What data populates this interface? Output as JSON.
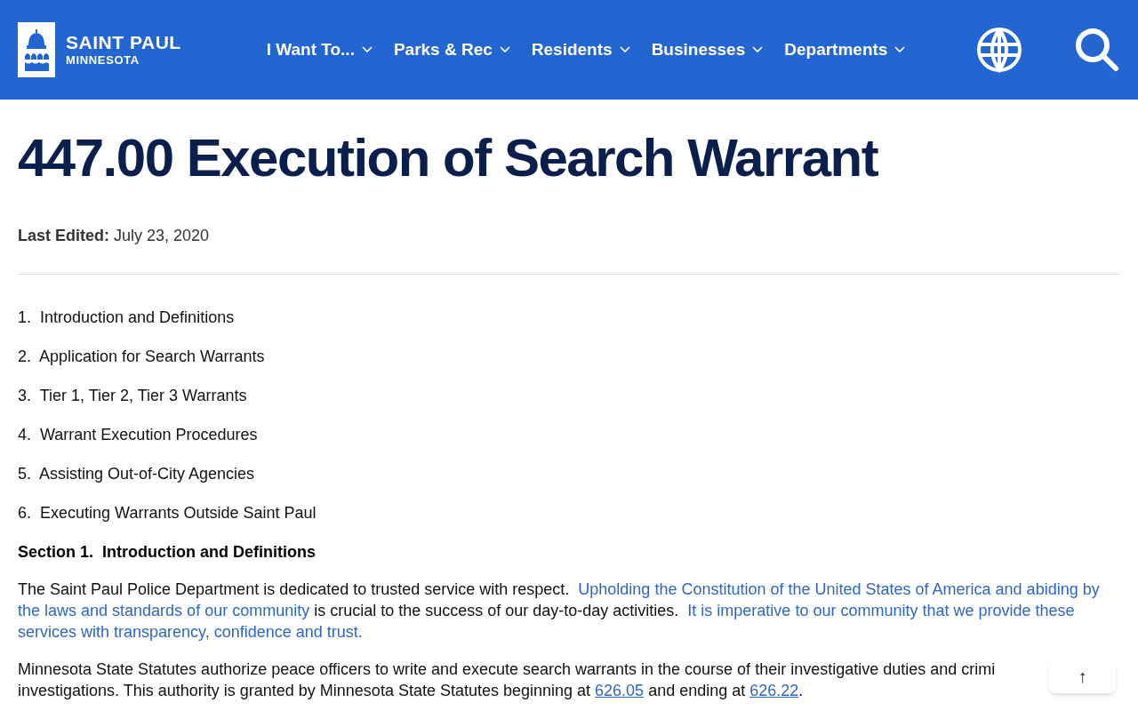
{
  "header": {
    "logo": {
      "name": "SAINT PAUL",
      "subtitle": "MINNESOTA"
    },
    "nav": [
      {
        "label": "I Want To..."
      },
      {
        "label": "Parks & Rec"
      },
      {
        "label": "Residents"
      },
      {
        "label": "Businesses"
      },
      {
        "label": "Departments"
      }
    ]
  },
  "page": {
    "title": "447.00 Execution of Search Warrant",
    "last_edited": "**Last Edited:** July 23, 2020",
    "contents": [
      {
        "number": "1.",
        "label": "Introduction and Definitions"
      },
      {
        "number": "2.",
        "label": "Application for Search Warrants"
      },
      {
        "number": "3.",
        "label": "Tier 1, Tier 2, Tier 3 Warrants"
      },
      {
        "number": "4.",
        "label": "Warrant Execution Procedures"
      },
      {
        "number": "5.",
        "label": "Assisting Out-of-City Agencies"
      },
      {
        "number": "6.",
        "label": "Executing Warrants Outside Saint Paul"
      }
    ],
    "section_heading": "Section 1.  Introduction and Definitions",
    "paragraphs": [
      {
        "lines": [
          [
            {
              "kind": "plain",
              "text": "The Saint Paul Police Department is dedicated to trusted service with respect.  "
            },
            {
              "kind": "highlight",
              "text": "Upholding the Constitution of the United States of America and abiding by the laws and standards of our community"
            },
            {
              "kind": "plain",
              "text": " is crucial to the success of our day-to-day activities.  "
            },
            {
              "kind": "highlight",
              "text": "It is imperative to our community that we provide these services with transparency, confidence and trust."
            }
          ]
        ]
      },
      {
        "lines": [
          [
            {
              "kind": "plain",
              "text": "Minnesota State Statutes authorize peace officers to write and execute search warrants in the course of their investigative duties and crimi"
            }
          ],
          [
            {
              "kind": "plain",
              "text": "investigations. This authority is granted by Minnesota State Statutes beginning at "
            },
            {
              "kind": "link",
              "text": "626.05"
            },
            {
              "kind": "plain",
              "text": " and ending at "
            },
            {
              "kind": "link",
              "text": "626.22"
            },
            {
              "kind": "plain",
              "text": "."
            }
          ]
        ]
      }
    ]
  },
  "back_to_top": {
    "label": "↑"
  }
}
